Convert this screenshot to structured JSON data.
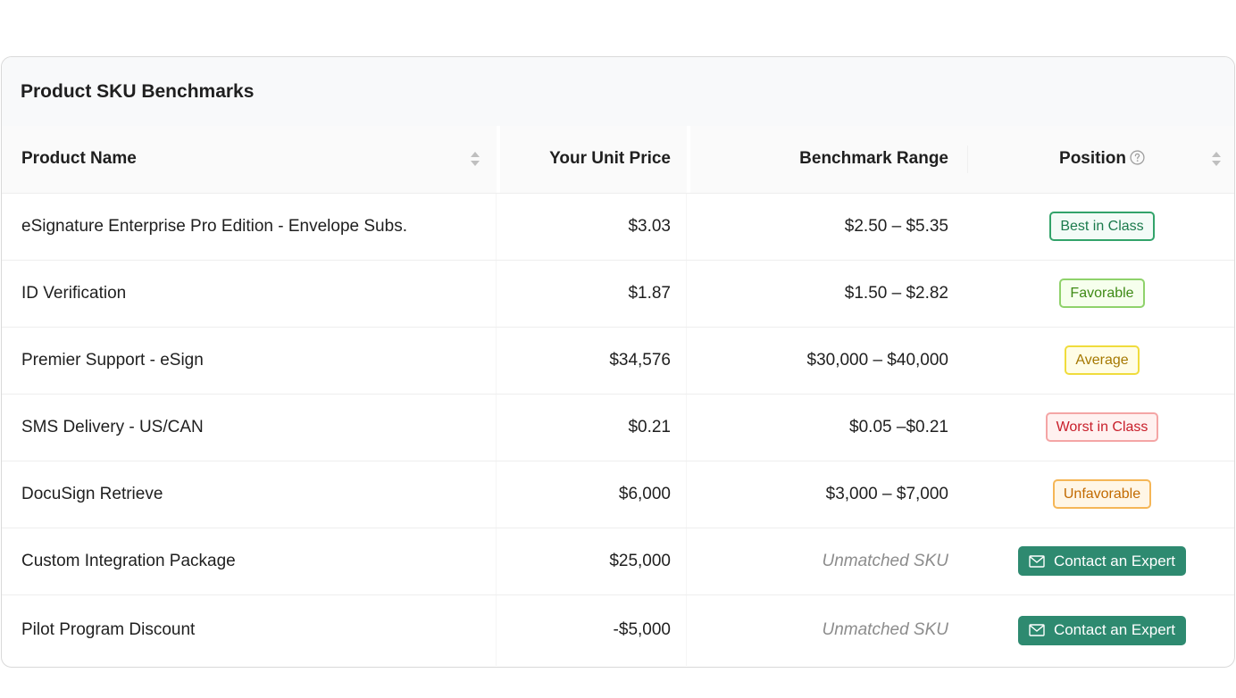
{
  "card": {
    "title": "Product SKU Benchmarks"
  },
  "columns": {
    "product_name": "Product Name",
    "unit_price": "Your Unit Price",
    "benchmark_range": "Benchmark Range",
    "position": "Position"
  },
  "rows": [
    {
      "name": "eSignature Enterprise Pro Edition - Envelope Subs.",
      "price": "$3.03",
      "range": "$2.50 – $5.35",
      "position": "Best in Class",
      "type": "badge",
      "variant": "best"
    },
    {
      "name": "ID Verification",
      "price": "$1.87",
      "range": "$1.50 – $2.82",
      "position": "Favorable",
      "type": "badge",
      "variant": "favorable"
    },
    {
      "name": "Premier Support - eSign",
      "price": "$34,576",
      "range": "$30,000 – $40,000",
      "position": "Average",
      "type": "badge",
      "variant": "average"
    },
    {
      "name": "SMS Delivery - US/CAN",
      "price": "$0.21",
      "range": "$0.05 –$0.21",
      "position": "Worst in Class",
      "type": "badge",
      "variant": "worst"
    },
    {
      "name": "DocuSign Retrieve",
      "price": "$6,000",
      "range": "$3,000 – $7,000",
      "position": "Unfavorable",
      "type": "badge",
      "variant": "unfavorable"
    },
    {
      "name": "Custom Integration Package",
      "price": "$25,000",
      "range": "Unmatched SKU",
      "position": "Contact an Expert",
      "type": "button",
      "variant": "contact"
    },
    {
      "name": "Pilot Program Discount",
      "price": "-$5,000",
      "range": "Unmatched SKU",
      "position": "Contact an Expert",
      "type": "button",
      "variant": "contact"
    }
  ],
  "icons": {
    "sort": "sort-icon",
    "help": "question-circle-icon",
    "mail": "mail-icon"
  },
  "colors": {
    "primary_button": "#2e8a70",
    "best": "#1b7a4c",
    "favorable": "#3f8a16",
    "average": "#a57800",
    "worst": "#c81e2a",
    "unfavorable": "#c26a00"
  }
}
